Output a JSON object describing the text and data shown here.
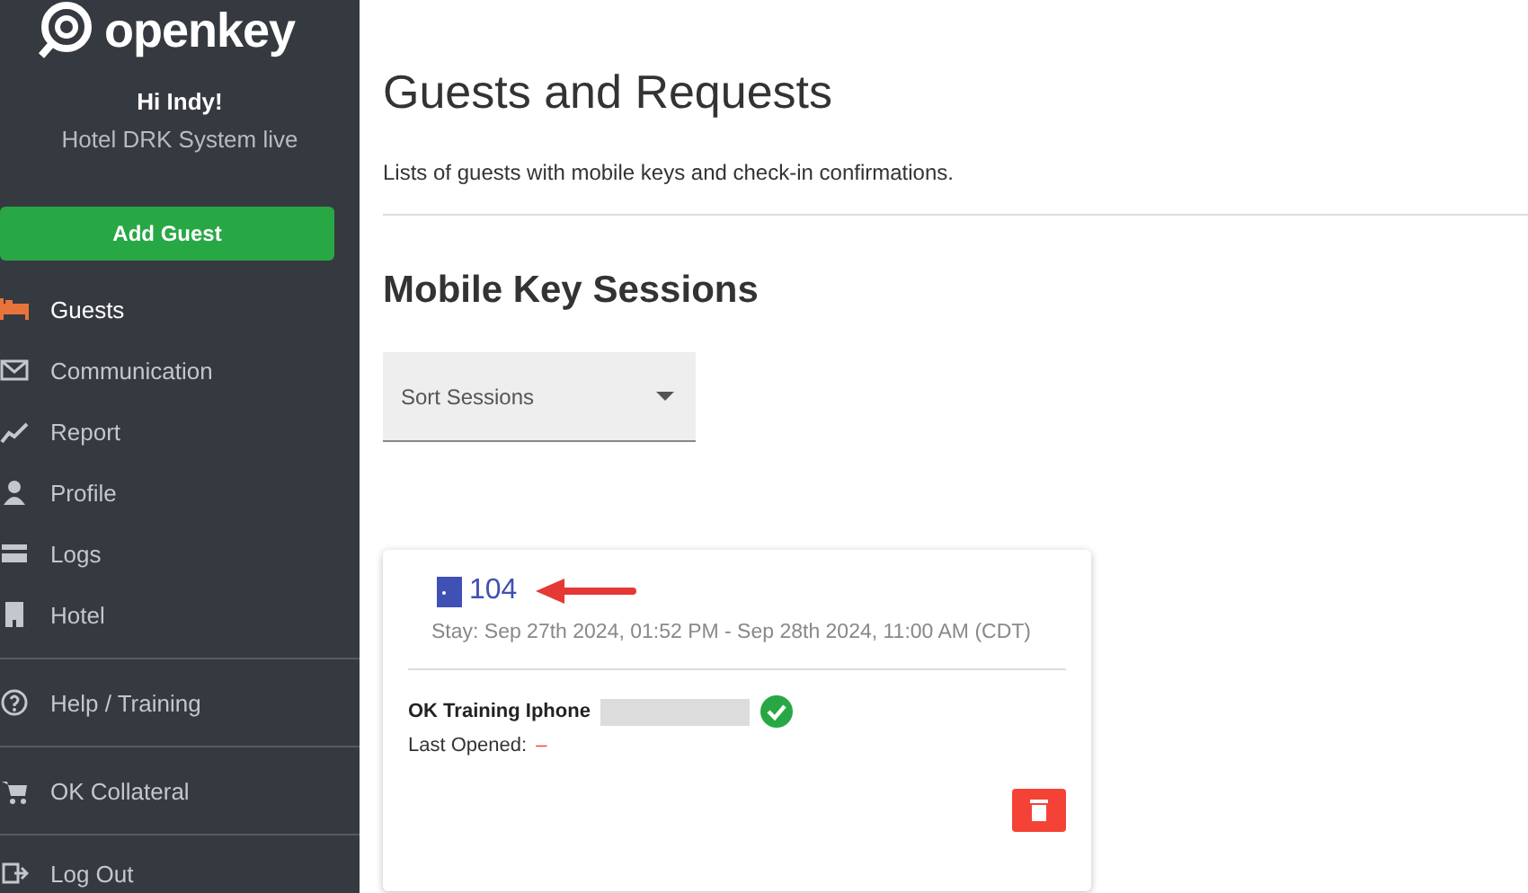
{
  "sidebar": {
    "logo": "openkey",
    "greeting": "Hi Indy!",
    "hotel": "Hotel DRK System live",
    "add_button": "Add Guest",
    "items": [
      {
        "label": "Guests",
        "kind": "bed",
        "selected": true
      },
      {
        "label": "Communication",
        "kind": "mail",
        "selected": false
      },
      {
        "label": "Report",
        "kind": "chart",
        "selected": false
      },
      {
        "label": "Profile",
        "kind": "person",
        "selected": false
      },
      {
        "label": "Logs",
        "kind": "card",
        "selected": false
      },
      {
        "label": "Hotel",
        "kind": "building",
        "selected": false,
        "divider": true
      },
      {
        "label": "Help / Training",
        "kind": "help",
        "selected": false,
        "divider": true
      },
      {
        "label": "OK Collateral",
        "kind": "cart",
        "selected": false,
        "divider": true
      },
      {
        "label": "Log Out",
        "kind": "logout",
        "selected": false
      }
    ]
  },
  "page": {
    "title": "Guests and Requests",
    "subtitle": "Lists of guests with mobile keys and check-in confirmations.",
    "section": "Mobile Key Sessions",
    "sort": {
      "placeholder": "Sort Sessions"
    }
  },
  "sessions": [
    {
      "room": "104",
      "stay": "Stay: Sep 27th 2024, 01:52 PM - Sep 28th 2024, 11:00 AM (CDT)",
      "device": "OK Training Iphone",
      "verified": true,
      "last_opened_label": "Last Opened:",
      "last_opened": "–"
    }
  ]
}
